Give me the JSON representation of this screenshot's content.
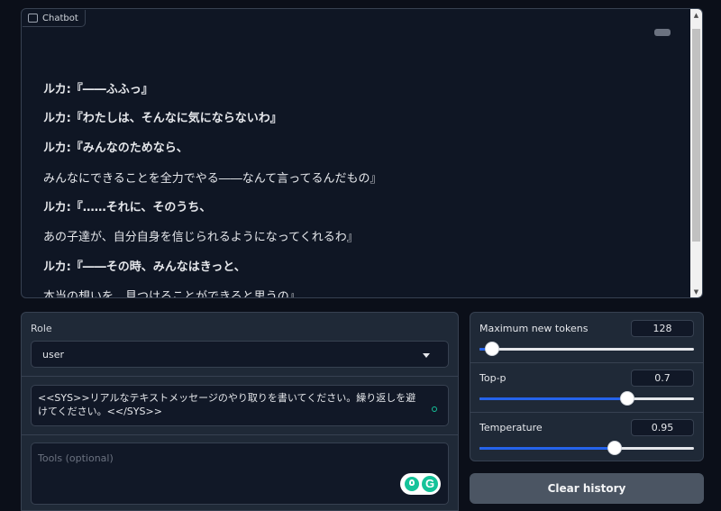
{
  "chatbot": {
    "label": "Chatbot",
    "messages": [
      {
        "text": "ルカ:『――ふふっ』",
        "bold": true
      },
      {
        "text": "ルカ:『わたしは、そんなに気にならないわ』",
        "bold": true
      },
      {
        "text": "ルカ:『みんなのためなら、",
        "bold": true
      },
      {
        "text": "みんなにできることを全力でやる――なんて言ってるんだもの』",
        "bold": false
      },
      {
        "text": "ルカ:『……それに、そのうち、",
        "bold": true
      },
      {
        "text": "あの子達が、自分自身を信じられるようになってくれるわ』",
        "bold": false
      },
      {
        "text": "ルカ:『――その時、みんなはきっと、",
        "bold": true
      },
      {
        "text": "本当の想いを、見つけることができると思うの』",
        "bold": false
      }
    ]
  },
  "role": {
    "label": "Role",
    "selected": "user"
  },
  "system_prompt": {
    "value": "<<SYS>>リアルなテキストメッセージのやり取りを書いてください。繰り返しを避けてください。<</SYS>>"
  },
  "tools": {
    "placeholder": "Tools (optional)"
  },
  "sliders": [
    {
      "label": "Maximum new tokens",
      "value": "128",
      "fraction": 0.06
    },
    {
      "label": "Top-p",
      "value": "0.7",
      "fraction": 0.69
    },
    {
      "label": "Temperature",
      "value": "0.95",
      "fraction": 0.63
    }
  ],
  "clear_button": {
    "label": "Clear history"
  },
  "colors": {
    "accent": "#2563eb",
    "grammarly": "#15c39a"
  }
}
